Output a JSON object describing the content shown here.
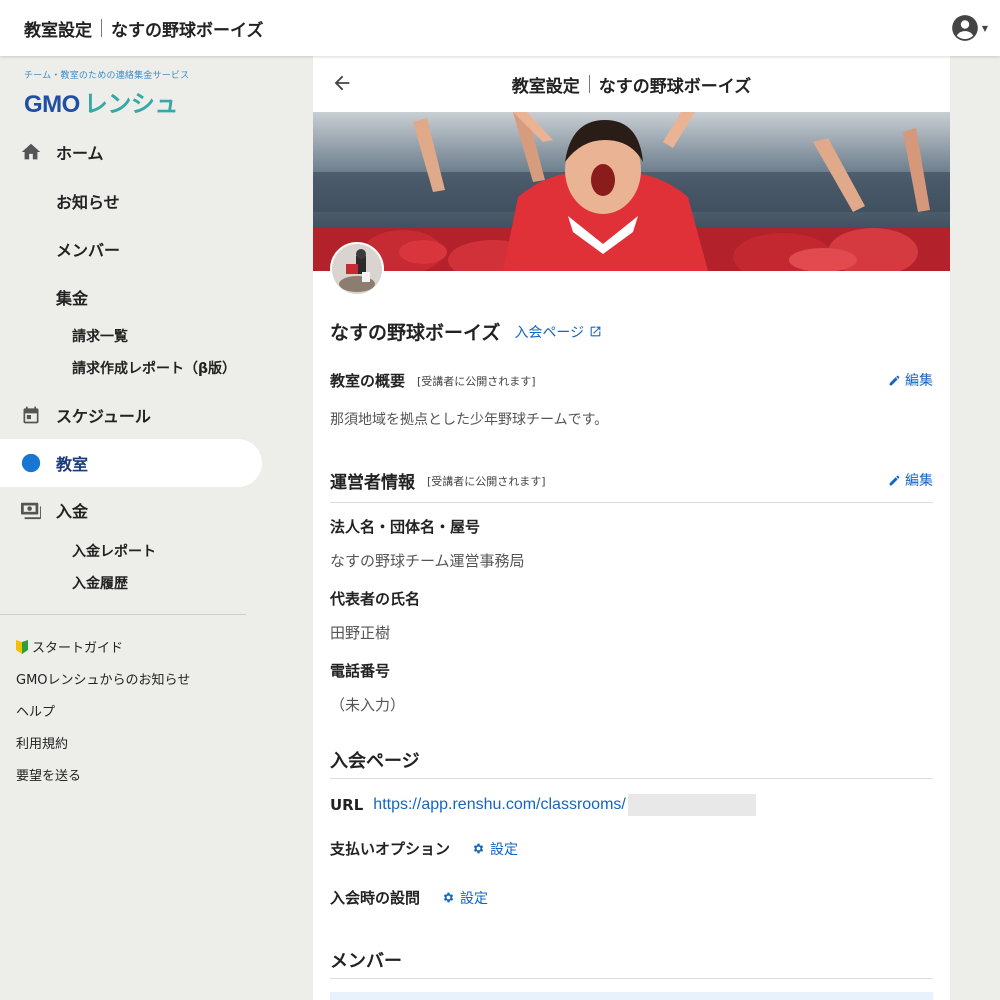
{
  "topbar": {
    "title_left": "教室設定",
    "title_right": "なすの野球ボーイズ",
    "account_icon": "account-circle-icon"
  },
  "logo": {
    "tagline": "チーム・教室のための連絡集金サービス",
    "brand_gmo": "GMO",
    "brand_renshu": "レンシュ"
  },
  "sidebar": {
    "home": "ホーム",
    "notice": "お知らせ",
    "members": "メンバー",
    "collection": "集金",
    "billing_list": "請求一覧",
    "billing_report": "請求作成レポート（β版）",
    "schedule": "スケジュール",
    "classroom": "教室",
    "deposit": "入金",
    "deposit_report": "入金レポート",
    "deposit_history": "入金履歴",
    "start_guide": "スタートガイド",
    "gmo_notice": "GMOレンシュからのお知らせ",
    "help": "ヘルプ",
    "terms": "利用規約",
    "feedback": "要望を送る"
  },
  "main": {
    "header_left": "教室設定",
    "header_right": "なすの野球ボーイズ",
    "club_name": "なすの野球ボーイズ",
    "join_page_link": "入会ページ",
    "overview": {
      "title": "教室の概要",
      "note": "[受講者に公開されます]",
      "edit": "編集",
      "description": "那須地域を拠点とした少年野球チームです。"
    },
    "operator": {
      "title": "運営者情報",
      "note": "[受講者に公開されます]",
      "edit": "編集",
      "org_label": "法人名・団体名・屋号",
      "org_value": "なすの野球チーム運営事務局",
      "rep_label": "代表者の氏名",
      "rep_value": "田野正樹",
      "phone_label": "電話番号",
      "phone_value": "（未入力）"
    },
    "join_page": {
      "title": "入会ページ",
      "url_label": "URL",
      "url_value": "https://app.renshu.com/classrooms/",
      "payment_option_label": "支払いオプション",
      "question_label": "入会時の設問",
      "set_label": "設定"
    },
    "members_title": "メンバー"
  }
}
